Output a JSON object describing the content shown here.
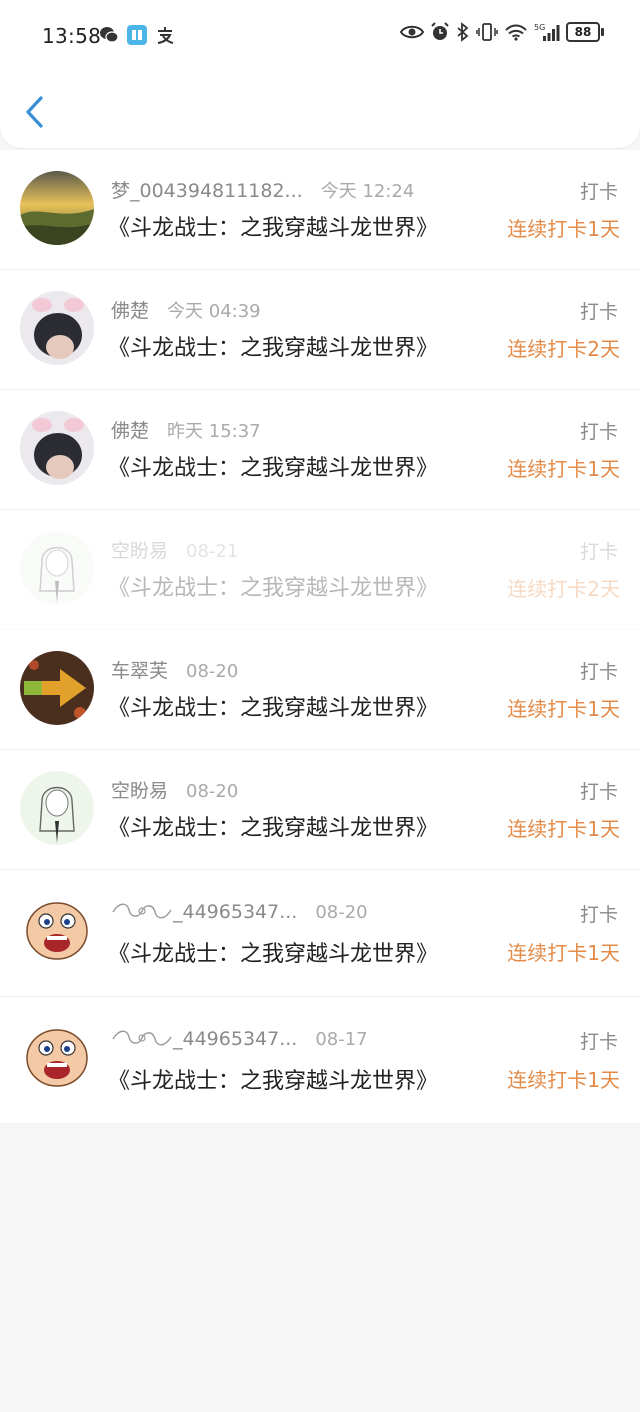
{
  "status_bar": {
    "time": "13:58",
    "battery": "88"
  },
  "colors": {
    "accent": "#e38b48",
    "back": "#3a8ed8"
  },
  "records": [
    {
      "name": "梦_004394811182...",
      "date": "今天 12:24",
      "book": "《斗龙战士：之我穿越斗龙世界》",
      "action": "打卡",
      "streak": "连续打卡1天"
    },
    {
      "name": "佛楚",
      "date": "今天 04:39",
      "book": "《斗龙战士：之我穿越斗龙世界》",
      "action": "打卡",
      "streak": "连续打卡2天"
    },
    {
      "name": "佛楚",
      "date": "昨天 15:37",
      "book": "《斗龙战士：之我穿越斗龙世界》",
      "action": "打卡",
      "streak": "连续打卡1天"
    },
    {
      "name": "空盼易",
      "date": "08-21",
      "book": "《斗龙战士：之我穿越斗龙世界》",
      "action": "打卡",
      "streak": "连续打卡2天"
    },
    {
      "name": "车翠芙",
      "date": "08-20",
      "book": "《斗龙战士：之我穿越斗龙世界》",
      "action": "打卡",
      "streak": "连续打卡1天"
    },
    {
      "name": "空盼易",
      "date": "08-20",
      "book": "《斗龙战士：之我穿越斗龙世界》",
      "action": "打卡",
      "streak": "连续打卡1天"
    },
    {
      "name": "_44965347...",
      "date": "08-20",
      "book": "《斗龙战士：之我穿越斗龙世界》",
      "action": "打卡",
      "streak": "连续打卡1天"
    },
    {
      "name": "_44965347...",
      "date": "08-17",
      "book": "《斗龙战士：之我穿越斗龙世界》",
      "action": "打卡",
      "streak": "连续打卡1天"
    }
  ]
}
